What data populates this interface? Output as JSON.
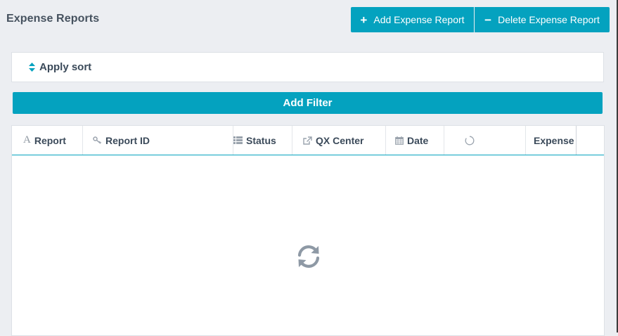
{
  "page": {
    "title": "Expense Reports"
  },
  "actions": {
    "add_label": "Add Expense Report",
    "delete_label": "Delete Expense Report",
    "add_icon": "plus-icon",
    "delete_icon": "minus-icon"
  },
  "sort": {
    "label": "Apply sort",
    "icon": "sort-icon"
  },
  "filter": {
    "label": "Add Filter"
  },
  "table": {
    "columns": [
      {
        "label": "Report",
        "icon": "text-icon"
      },
      {
        "label": "Report ID",
        "icon": "key-icon"
      },
      {
        "label": "Status",
        "icon": "list-icon"
      },
      {
        "label": "QX Center",
        "icon": "external-link-icon"
      },
      {
        "label": "Date",
        "icon": "calendar-icon"
      },
      {
        "label": "",
        "icon": "circle-notch-icon"
      },
      {
        "label": "Expense",
        "icon": ""
      }
    ],
    "state": "loading",
    "loading_icon": "refresh-icon"
  },
  "colors": {
    "accent": "#04a2bf",
    "background": "#eceef2",
    "text": "#3b4a5a"
  }
}
